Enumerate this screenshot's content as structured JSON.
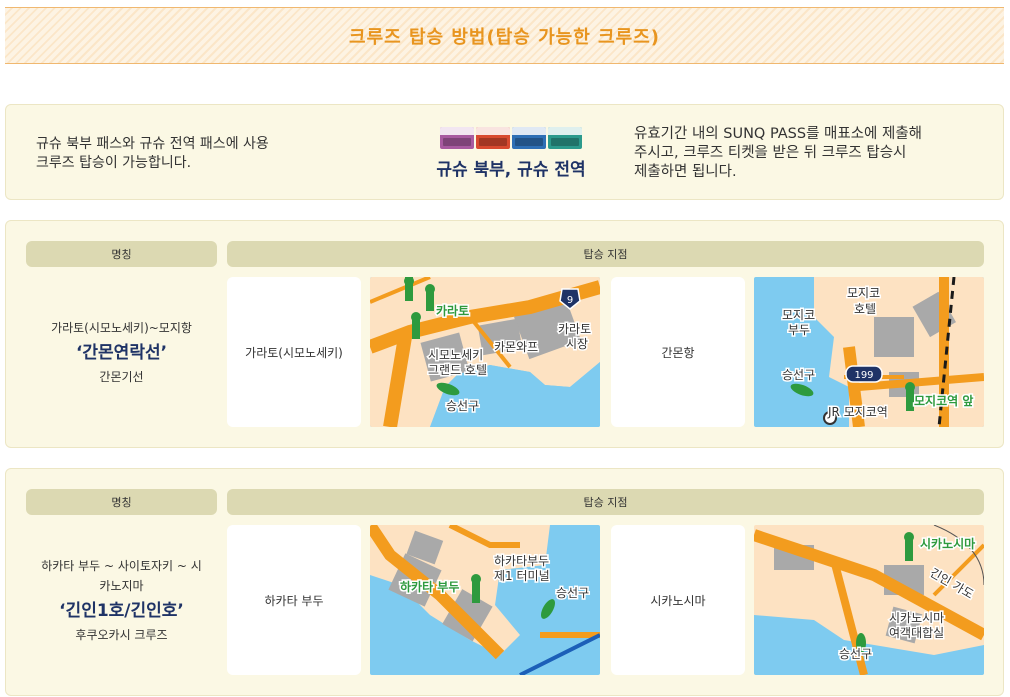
{
  "header": {
    "title": "크루즈 탑승 방법(탑승 가능한 크루즈)"
  },
  "info": {
    "left_line1": "규슈 북부 패스와 규슈 전역 패스에 사용",
    "left_line2": "크루즈 탑승이 가능합니다.",
    "pass_name": "규슈 북부, 규슈 전역",
    "right_line1": "유효기간 내의 SUNQ PASS를 매표소에 제출해",
    "right_line2": "주시고, 크루즈 티켓을 받은 뒤 크루즈 탑승시",
    "right_line3": "제출하면 됩니다.",
    "pass_cards": [
      {
        "color": "#a85aa0"
      },
      {
        "color": "#d8492f"
      },
      {
        "color": "#2e6fb5"
      },
      {
        "color": "#2b9a8c"
      }
    ]
  },
  "table_header": {
    "name": "명칭",
    "points": "탑승 지점"
  },
  "cruises": [
    {
      "route": "가라토(시모노세키)~모지항",
      "title": "‘간몬연락선’",
      "company": "간몬기선",
      "point1": "가라토(시모노세키)",
      "point2": "간몬항",
      "map1_labels": {
        "karato": "카라토",
        "shimonoseki_l1": "시모노세키",
        "shimonoseki_l2": "그랜드 호텔",
        "kamonwharf": "카몬와프",
        "market_l1": "카라토",
        "market_l2": "시장",
        "pier": "승선구",
        "route_no": "9"
      },
      "map2_labels": {
        "pier_l1": "모지코",
        "pier_l2": "부두",
        "hotel_l1": "모지코",
        "hotel_l2": "호텔",
        "gate": "승선구",
        "station": "JR 모지코역",
        "stop": "모지코역 앞",
        "route_no": "199"
      }
    },
    {
      "route_l1": "하카타 부두 ~ 사이토자키 ~ 시",
      "route_l2": "카노지마",
      "title": "‘긴인1호/긴인호’",
      "company": "후쿠오카시 크루즈",
      "point1": "하카타 부두",
      "point2": "시카노시마",
      "map3_labels": {
        "terminal_l1": "하카타부두",
        "terminal_l2": "제1 터미널",
        "stop": "하카타 부두",
        "gate": "승선구"
      },
      "map4_labels": {
        "stop": "시카노시마",
        "road": "긴인 가도",
        "building_l1": "시카노시마",
        "building_l2": "여객대합실",
        "gate": "승선구"
      }
    }
  ],
  "colors": {
    "accent": "#e8951f",
    "navy": "#1f3366",
    "section_bg": "#fbf8e4",
    "header_cell": "#dcd9b2",
    "water": "#7ecbf0",
    "land": "#fde2c2",
    "road": "#f39c1e",
    "building": "#a9a9a9",
    "marker": "#2e9a3e"
  }
}
